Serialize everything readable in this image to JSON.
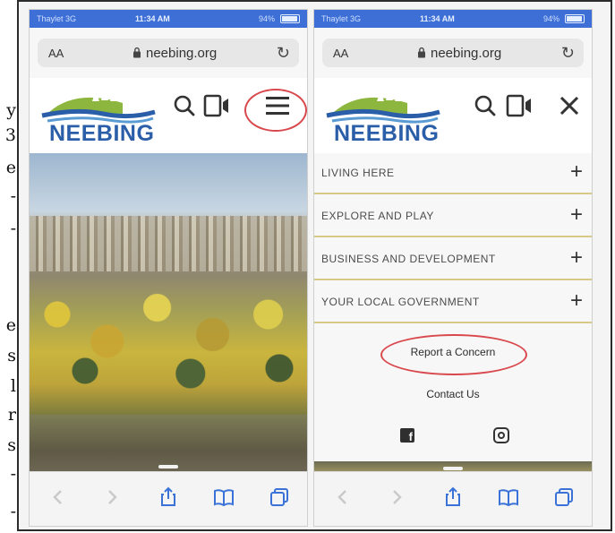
{
  "doc_margin_chars": [
    "y",
    "3",
    "e",
    "-",
    "-",
    "e",
    "s",
    "l",
    "r",
    "s",
    "-",
    "-"
  ],
  "screenshots": [
    {
      "status": {
        "carrier": "Thaylet 3G",
        "time": "11:34 AM",
        "battery": "94%"
      },
      "browser": {
        "text_size": "AA",
        "url": "neebing.org"
      },
      "site": {
        "logo_text": "NEEBING"
      }
    },
    {
      "status": {
        "carrier": "Thaylet 3G",
        "time": "11:34 AM",
        "battery": "94%"
      },
      "browser": {
        "text_size": "AA",
        "url": "neebing.org"
      },
      "site": {
        "logo_text": "NEEBING"
      },
      "menu": {
        "items": [
          {
            "label": "LIVING HERE"
          },
          {
            "label": "EXPLORE AND PLAY"
          },
          {
            "label": "BUSINESS AND DEVELOPMENT"
          },
          {
            "label": "YOUR LOCAL GOVERNMENT"
          }
        ],
        "expand_symbol": "+",
        "report_link": "Report a Concern",
        "contact_link": "Contact Us",
        "social": [
          "facebook-icon",
          "instagram-icon"
        ]
      }
    }
  ],
  "colors": {
    "status_bar": "#3d6fd6",
    "annotation_circle": "#d8484c",
    "menu_divider": "#d9c88a",
    "logo_blue": "#2b5ea8"
  }
}
